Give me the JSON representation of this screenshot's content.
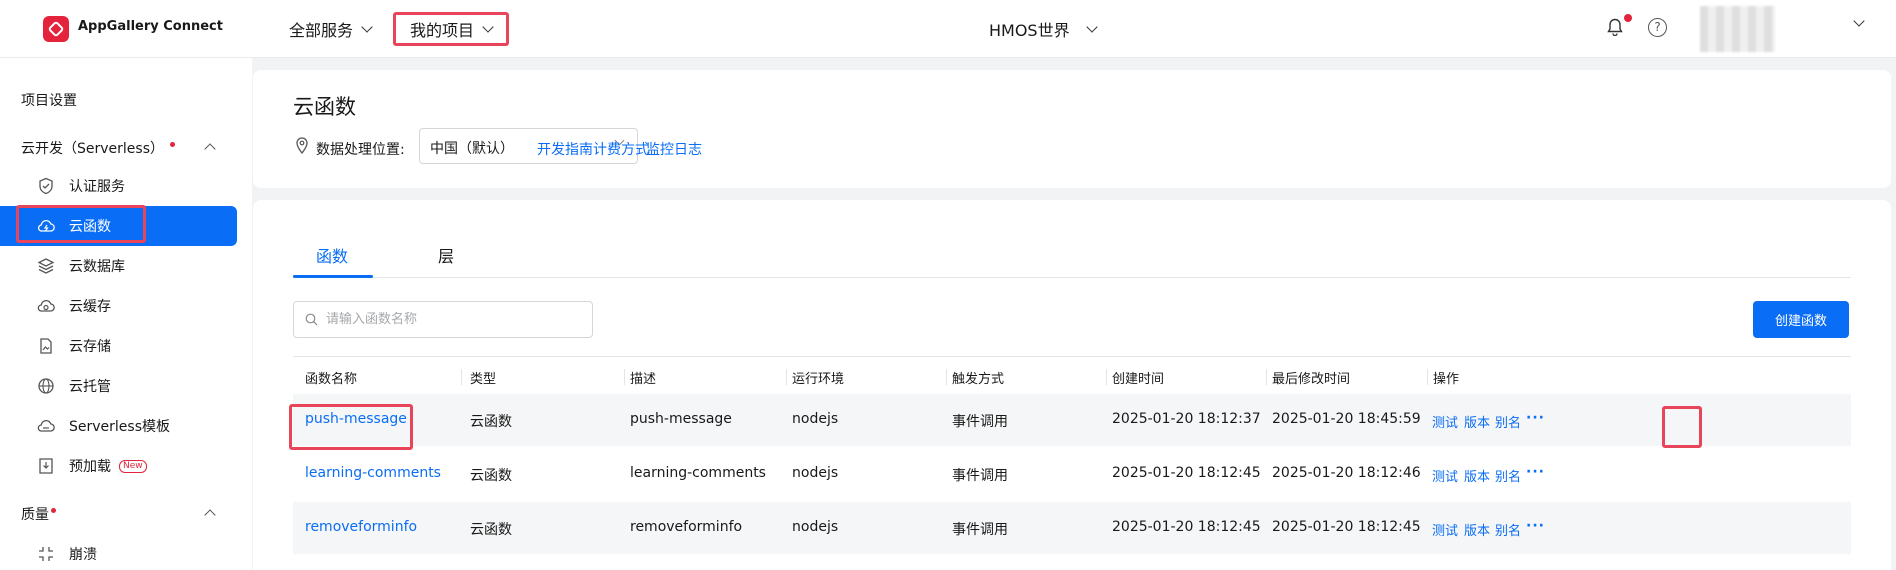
{
  "header": {
    "brand": "AppGallery Connect",
    "nav_all": "全部服务",
    "nav_mine": "我的项目",
    "project": "HMOS世界"
  },
  "sidebar": {
    "project_settings": "项目设置",
    "serverless_section": "云开发（Serverless）",
    "items": [
      {
        "label": "认证服务",
        "icon": "shield-check-icon"
      },
      {
        "label": "云函数",
        "icon": "cloud-function-icon",
        "active": true
      },
      {
        "label": "云数据库",
        "icon": "database-layers-icon"
      },
      {
        "label": "云缓存",
        "icon": "cache-icon"
      },
      {
        "label": "云存储",
        "icon": "storage-icon"
      },
      {
        "label": "云托管",
        "icon": "globe-icon"
      },
      {
        "label": "Serverless模板",
        "icon": "template-icon"
      },
      {
        "label": "预加载",
        "icon": "preload-icon",
        "badge": "New"
      }
    ],
    "quality_section": "质量",
    "quality_items": [
      {
        "label": "崩溃",
        "icon": "crash-icon"
      }
    ]
  },
  "region": {
    "title": "云函数",
    "label": "数据处理位置:",
    "value": "中国（默认）",
    "links": [
      "开发指南",
      "计费方式",
      "监控日志"
    ]
  },
  "tabs": [
    "函数",
    "层"
  ],
  "search": {
    "placeholder": "请输入函数名称"
  },
  "create_button": "创建函数",
  "table": {
    "columns": [
      "函数名称",
      "类型",
      "描述",
      "运行环境",
      "触发方式",
      "创建时间",
      "最后修改时间",
      "操作"
    ],
    "rows": [
      [
        "push-message",
        "云函数",
        "push-message",
        "nodejs",
        "事件调用",
        "2025-01-20 18:12:37",
        "2025-01-20 18:45:59"
      ],
      [
        "learning-comments",
        "云函数",
        "learning-comments",
        "nodejs",
        "事件调用",
        "2025-01-20 18:12:45",
        "2025-01-20 18:12:46"
      ],
      [
        "removeforminfo",
        "云函数",
        "removeforminfo",
        "nodejs",
        "事件调用",
        "2025-01-20 18:12:45",
        "2025-01-20 18:12:45"
      ]
    ],
    "actions": [
      "测试",
      "版本",
      "别名",
      "···"
    ]
  },
  "colors": {
    "accent": "#0a6df5",
    "brand_red": "#e3243c",
    "highlight": "#e8445a"
  }
}
